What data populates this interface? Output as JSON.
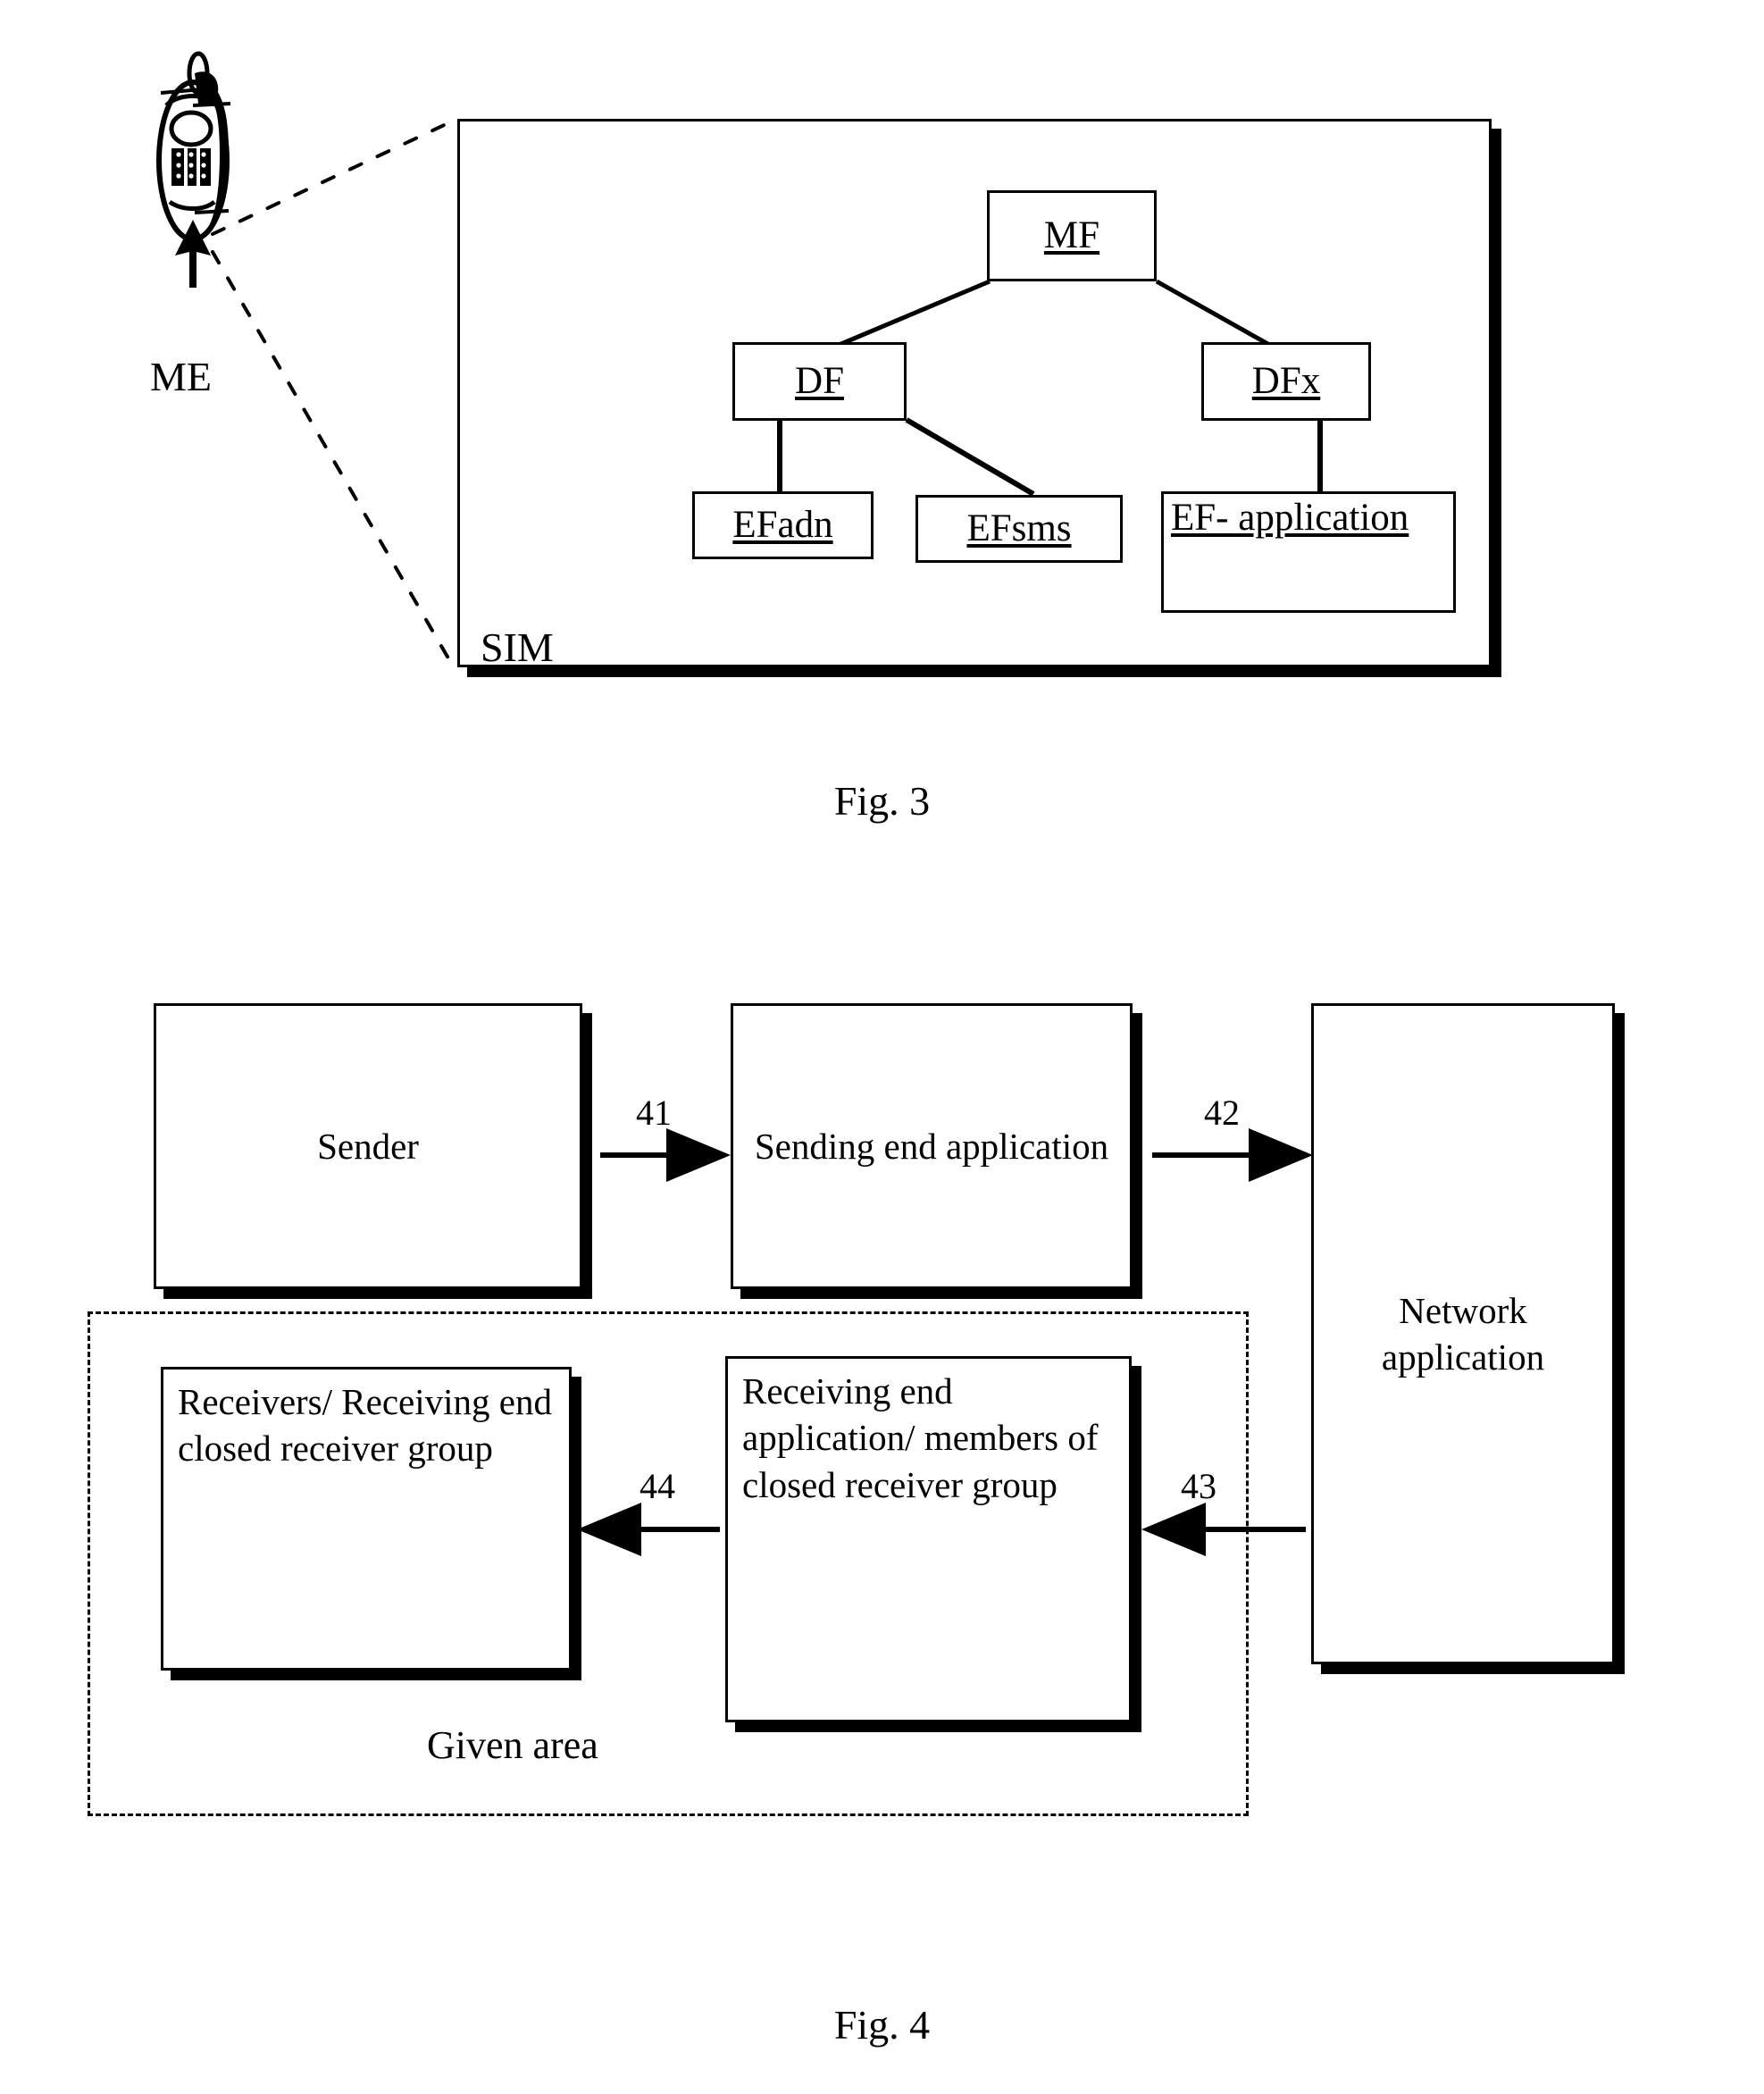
{
  "figure3": {
    "caption": "Fig. 3",
    "device_label": "ME",
    "device_icon": "mobile-phone-icon",
    "container_label": "SIM",
    "nodes": [
      {
        "id": "mf",
        "label": "MF"
      },
      {
        "id": "df",
        "label": "DF"
      },
      {
        "id": "dfx",
        "label": "DFx"
      },
      {
        "id": "efadn",
        "label": "EFadn"
      },
      {
        "id": "efsms",
        "label": "EFsms"
      },
      {
        "id": "efapp",
        "label": "EF-\napplication"
      }
    ],
    "edges": [
      {
        "from": "mf",
        "to": "df"
      },
      {
        "from": "mf",
        "to": "dfx"
      },
      {
        "from": "df",
        "to": "efadn"
      },
      {
        "from": "df",
        "to": "efsms"
      },
      {
        "from": "dfx",
        "to": "efapp"
      }
    ]
  },
  "figure4": {
    "caption": "Fig. 4",
    "region_label": "Given area",
    "boxes": {
      "sender": "Sender",
      "sending_end_application": "Sending end application",
      "network_application": "Network application",
      "receivers": "Receivers/ Receiving end closed receiver group",
      "receiving_end_application": "Receiving end application/ members of closed receiver group"
    },
    "arrows": [
      {
        "id": "a41",
        "label": "41",
        "from": "sender",
        "to": "sending_end_application",
        "direction": "right"
      },
      {
        "id": "a42",
        "label": "42",
        "from": "sending_end_application",
        "to": "network_application",
        "direction": "right"
      },
      {
        "id": "a43",
        "label": "43",
        "from": "network_application",
        "to": "receiving_end_application",
        "direction": "left"
      },
      {
        "id": "a44",
        "label": "44",
        "from": "receiving_end_application",
        "to": "receivers",
        "direction": "left"
      }
    ]
  },
  "colors": {
    "ink": "#000000",
    "paper": "#ffffff"
  }
}
